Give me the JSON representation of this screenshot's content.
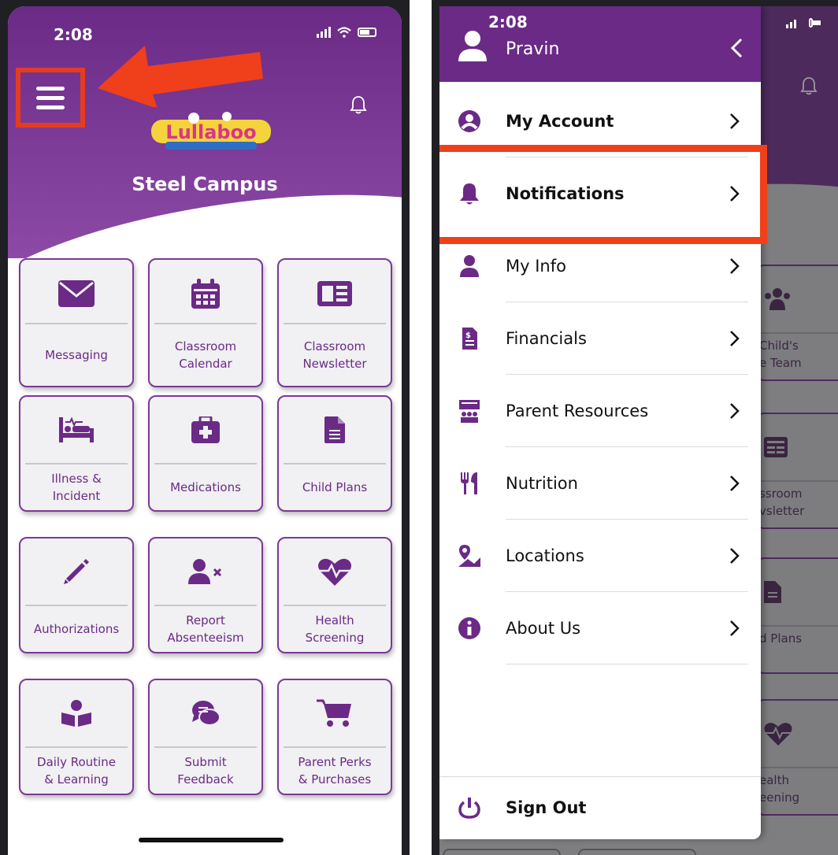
{
  "left": {
    "status_time": "2:08",
    "campus": "Steel Campus",
    "tiles": [
      {
        "label": "Messaging",
        "icon": "envelope-icon"
      },
      {
        "label": "Classroom\nCalendar",
        "icon": "calendar-icon"
      },
      {
        "label": "Classroom\nNewsletter",
        "icon": "newspaper-icon"
      },
      {
        "label": "Illness &\nIncident",
        "icon": "bed-icon"
      },
      {
        "label": "Medications",
        "icon": "medkit-icon"
      },
      {
        "label": "Child Plans",
        "icon": "document-icon"
      },
      {
        "label": "Authorizations",
        "icon": "pencil-icon"
      },
      {
        "label": "Report\nAbsenteeism",
        "icon": "user-x-icon"
      },
      {
        "label": "Health\nScreening",
        "icon": "heartbeat-icon"
      },
      {
        "label": "Daily Routine\n& Learning",
        "icon": "reader-icon"
      },
      {
        "label": "Submit\nFeedback",
        "icon": "chat-icon"
      },
      {
        "label": "Parent Perks\n& Purchases",
        "icon": "cart-icon"
      }
    ]
  },
  "right": {
    "status_time": "2:08",
    "user_name": "Pravin",
    "menu": [
      {
        "label": "My Account",
        "bold": true,
        "icon": "account-circle-icon"
      },
      {
        "label": "Notifications",
        "bold": true,
        "icon": "bell-icon"
      },
      {
        "label": "My Info",
        "bold": false,
        "icon": "user-icon"
      },
      {
        "label": "Financials",
        "bold": false,
        "icon": "invoice-icon"
      },
      {
        "label": "Parent Resources",
        "bold": false,
        "icon": "presentation-icon"
      },
      {
        "label": "Nutrition",
        "bold": false,
        "icon": "utensils-icon"
      },
      {
        "label": "Locations",
        "bold": false,
        "icon": "map-pin-icon"
      },
      {
        "label": "About Us",
        "bold": false,
        "icon": "info-icon"
      }
    ],
    "sign_out": "Sign Out",
    "background_tiles": [
      {
        "label": "Child's\ne Team"
      },
      {
        "label": "ssroom\nvsletter"
      },
      {
        "label": "d Plans"
      },
      {
        "label": "ealth\neening"
      }
    ]
  },
  "colors": {
    "brand_purple": "#6a2a86",
    "annotation_red": "#e63c1e"
  }
}
